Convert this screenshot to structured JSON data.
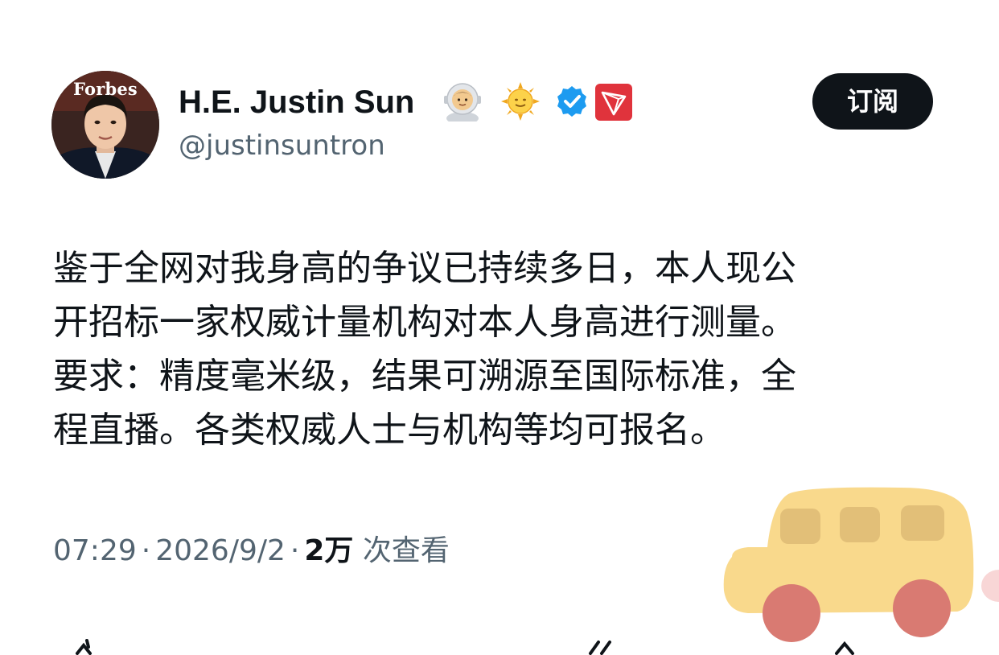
{
  "author": {
    "avatar_brand_text": "Forbes",
    "display_name": "H.E. Justin Sun",
    "handle": "@justinsuntron",
    "badges": [
      "astronaut-emoji",
      "sun-emoji",
      "verified-badge",
      "tron-logo"
    ]
  },
  "subscribe_label": "订阅",
  "tweet": {
    "lines": [
      "鉴于全网对我身高的争议已持续多日，本人现公",
      "开招标一家权威计量机构对本人身高进行测量。",
      "要求：精度毫米级，结果可溯源至国际标准，全",
      "程直播。各类权威人士与机构等均可报名。"
    ]
  },
  "meta": {
    "time": "07:29",
    "date": "2026/9/2",
    "views_count": "2万",
    "views_label": "次查看",
    "separator": "·"
  },
  "colors": {
    "text_primary": "#0f1419",
    "text_secondary": "#536471",
    "verified_blue": "#1d9bf0",
    "tron_red": "#e0333c",
    "button_bg": "#0f1419",
    "sticker_body": "#f9d98c",
    "sticker_wheel": "#d97a72"
  }
}
